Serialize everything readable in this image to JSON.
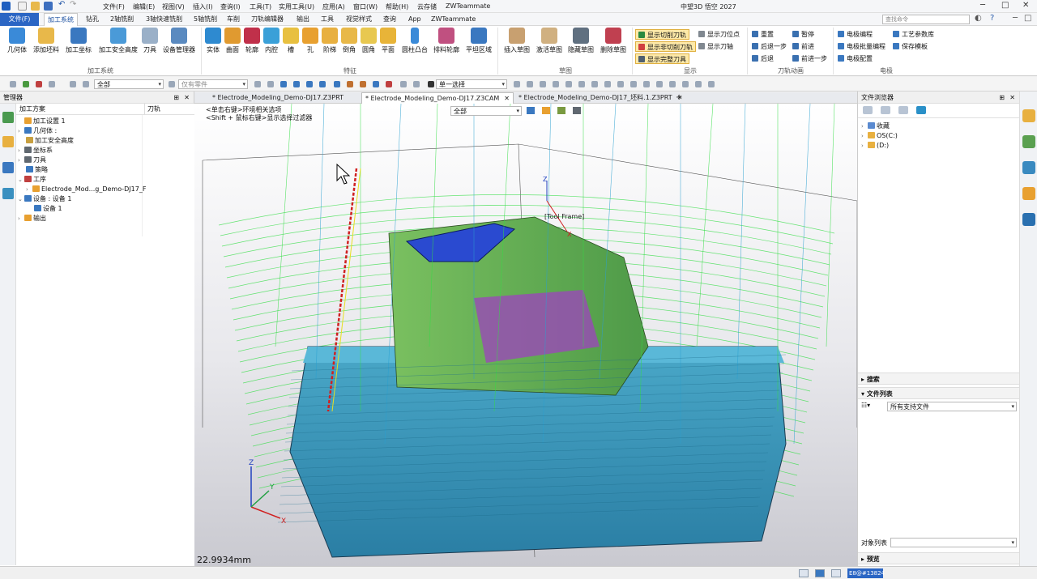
{
  "app": {
    "title": "中望3D 悟空 2027"
  },
  "menubar": [
    "文件(F)",
    "编辑(E)",
    "视图(V)",
    "插入(I)",
    "查询(I)",
    "工具(T)",
    "实用工具(U)",
    "应用(A)",
    "窗口(W)",
    "帮助(H)",
    "云存储",
    "ZWTeammate"
  ],
  "ribbon_tabs": [
    {
      "label": "文件(F)"
    },
    {
      "label": "加工系统"
    },
    {
      "label": "钻孔"
    },
    {
      "label": "2轴铣削"
    },
    {
      "label": "3轴快速铣削"
    },
    {
      "label": "5轴铣削"
    },
    {
      "label": "车削"
    },
    {
      "label": "刀轨编辑器"
    },
    {
      "label": "输出"
    },
    {
      "label": "工具"
    },
    {
      "label": "视觉样式"
    },
    {
      "label": "查询"
    },
    {
      "label": "App"
    },
    {
      "label": "ZWTeammate"
    }
  ],
  "search": {
    "placeholder": "查找命令"
  },
  "ribbon": {
    "group1": {
      "label": "加工系统",
      "buttons": [
        "几何体",
        "添加坯料",
        "加工坐标",
        "加工安全高度",
        "刀具",
        "设备管理器"
      ]
    },
    "group2": {
      "label": "特征",
      "buttons": [
        "实体",
        "曲面",
        "轮廓",
        "内腔",
        "槽",
        "孔",
        "阶梯",
        "倒角",
        "圆角",
        "平面",
        "圆柱凸台",
        "排料轮廓",
        "平坦区域"
      ]
    },
    "group3": {
      "label": "草图",
      "buttons": [
        "插入草图",
        "激活草图",
        "隐藏草图",
        "删除草图"
      ]
    },
    "group4": {
      "label": "显示",
      "items": [
        "显示切削刀轨",
        "显示非切削刀轨",
        "显示完整刀具",
        "显示刀位点",
        "显示刀轴"
      ]
    },
    "group5": {
      "label": "刀轨动画",
      "items": [
        "重置",
        "后退一步",
        "后退",
        "暂停",
        "前进",
        "前进一步"
      ]
    },
    "group6": {
      "label": "电极",
      "items": [
        "电极编程",
        "电极批量编程",
        "电极配置",
        "工艺参数库",
        "保存模板"
      ]
    }
  },
  "toolbar2": {
    "filter_all": "全部",
    "part_only": "仅有零件",
    "select_mode": "单一选择"
  },
  "manager": {
    "title": "管理器",
    "col_plan": "加工方案",
    "col_path": "刀轨",
    "tree": [
      {
        "label": "加工设置 1",
        "indent": 0
      },
      {
        "label": "几何体 :",
        "indent": 1
      },
      {
        "label": "加工安全高度",
        "indent": 1
      },
      {
        "label": "坐标系",
        "indent": 1
      },
      {
        "label": "刀具",
        "indent": 1
      },
      {
        "label": "策略",
        "indent": 1
      },
      {
        "label": "工序",
        "indent": 1
      },
      {
        "label": "Electrode_Mod...g_Demo-DJ17_F",
        "indent": 2
      },
      {
        "label": "设备 : 设备 1",
        "indent": 1
      },
      {
        "label": "设备 1",
        "indent": 2
      },
      {
        "label": "输出",
        "indent": 1
      }
    ]
  },
  "doc_tabs": [
    {
      "label": "* Electrode_Modeling_Demo-DJ17.Z3PRT"
    },
    {
      "label": "* Electrode_Modeling_Demo-DJ17.Z3CAM"
    },
    {
      "label": "* Electrode_Modeling_Demo-DJ17_坯料.1.Z3PRT"
    }
  ],
  "viewport": {
    "hint1": "<单击右键>环境相关选项",
    "hint2": "<Shift + 鼠标右键>显示选择过滤器",
    "filter": "全部",
    "tool_frame": "[Tool Frame]",
    "measure": "22.9934mm",
    "axis_z": "Z",
    "axis_x": "X",
    "axis_y": "Y"
  },
  "file_browser": {
    "title": "文件浏览器",
    "items": [
      "收藏",
      "OS(C:)",
      "(D:)"
    ],
    "search_label": "搜索",
    "filelist_label": "文件列表",
    "filter": "所有支持文件",
    "object_list": "对象列表",
    "preview": "预览"
  },
  "status": {
    "text": "E8@#13824"
  },
  "colors": {
    "accent": "#2b66c4",
    "toolpath": "#33dd44",
    "part": "#3fa7c9",
    "background": "#f0f0f0"
  }
}
